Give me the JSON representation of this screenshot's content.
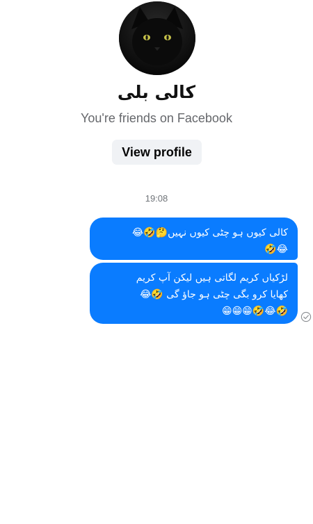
{
  "profile": {
    "name": "کالی بلی",
    "status": "You're friends on Facebook",
    "view_profile_label": "View profile",
    "avatar_description": "black-cat-avatar"
  },
  "chat": {
    "timestamp": "19:08",
    "messages": [
      {
        "lines": [
          "کالی کیوں ہو چٹی کیوں نہیں🤔🤣😂",
          "😂🤣"
        ]
      },
      {
        "lines": [
          "لڑکیاں کریم لگاتی ہیں لیکن آپ کریم",
          "کھایا کرو بگی چٹی ہو جاؤ گی 🤣😂",
          "🤣😂🤣😁😁😁"
        ]
      }
    ]
  },
  "colors": {
    "accent": "#0a7cff",
    "button_bg": "#f0f2f5",
    "muted_text": "#65676b"
  },
  "icons": {
    "delivered": "check-circle-icon"
  }
}
